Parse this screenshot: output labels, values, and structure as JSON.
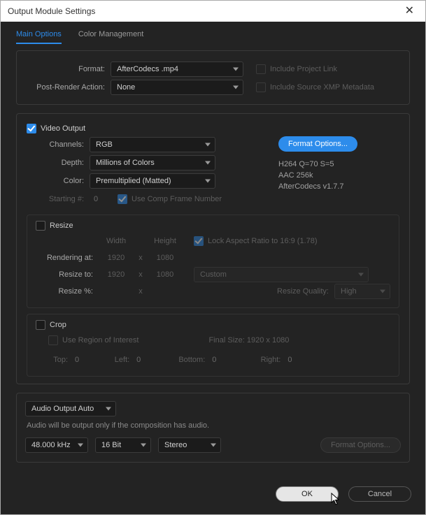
{
  "window": {
    "title": "Output Module Settings"
  },
  "tabs": {
    "main": "Main Options",
    "color": "Color Management"
  },
  "top": {
    "format_label": "Format:",
    "format_value": "AfterCodecs .mp4",
    "post_render_label": "Post-Render Action:",
    "post_render_value": "None",
    "include_project_link": "Include Project Link",
    "include_xmp": "Include Source XMP Metadata"
  },
  "video": {
    "section": "Video Output",
    "channels_label": "Channels:",
    "channels_value": "RGB",
    "depth_label": "Depth:",
    "depth_value": "Millions of Colors",
    "color_label": "Color:",
    "color_value": "Premultiplied (Matted)",
    "starting_label": "Starting #:",
    "starting_value": "0",
    "use_comp_frame": "Use Comp Frame Number",
    "format_options_btn": "Format Options...",
    "info1": "H264 Q=70 S=5",
    "info2": "AAC 256k",
    "info3": "AfterCodecs v1.7.7"
  },
  "resize": {
    "section": "Resize",
    "width_label": "Width",
    "height_label": "Height",
    "lock_aspect": "Lock Aspect Ratio to 16:9 (1.78)",
    "rendering_at_label": "Rendering at:",
    "rendering_w": "1920",
    "rendering_h": "1080",
    "resize_to_label": "Resize to:",
    "resize_w": "1920",
    "resize_h": "1080",
    "resize_preset": "Custom",
    "resize_pct_label": "Resize %:",
    "resize_quality_label": "Resize Quality:",
    "resize_quality_value": "High",
    "x": "x"
  },
  "crop": {
    "section": "Crop",
    "use_roi": "Use Region of Interest",
    "final_size_label": "Final Size: 1920 x 1080",
    "top_label": "Top:",
    "top_val": "0",
    "left_label": "Left:",
    "left_val": "0",
    "bottom_label": "Bottom:",
    "bottom_val": "0",
    "right_label": "Right:",
    "right_val": "0"
  },
  "audio": {
    "mode": "Audio Output Auto",
    "hint": "Audio will be output only if the composition has audio.",
    "sample_rate": "48.000 kHz",
    "bit_depth": "16 Bit",
    "channels": "Stereo",
    "format_options_btn": "Format Options..."
  },
  "footer": {
    "ok": "OK",
    "cancel": "Cancel"
  }
}
